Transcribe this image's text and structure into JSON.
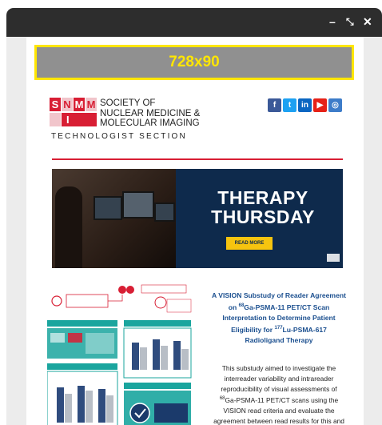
{
  "window": {
    "minimize": "–",
    "restore": "⤡",
    "close": "✕"
  },
  "ad": {
    "label": "728x90"
  },
  "logo": {
    "blocks": [
      "S",
      "N",
      "M",
      "M",
      "I"
    ],
    "lines": [
      "SOCIETY OF",
      "NUCLEAR MEDICINE &",
      "MOLECULAR IMAGING"
    ],
    "section": "TECHNOLOGIST SECTION"
  },
  "social": [
    {
      "icon": "facebook-icon",
      "glyph": "f",
      "color": "#3b5998"
    },
    {
      "icon": "twitter-icon",
      "glyph": "t",
      "color": "#1da1f2"
    },
    {
      "icon": "linkedin-icon",
      "glyph": "in",
      "color": "#0a66c2"
    },
    {
      "icon": "youtube-icon",
      "glyph": "▶",
      "color": "#e62117"
    },
    {
      "icon": "instagram-icon",
      "glyph": "◎",
      "color": "#3d7cc9"
    }
  ],
  "colors": {
    "brand_red": "#d81e34",
    "navy": "#0e2a4c",
    "teal": "#1aa59e",
    "title_blue": "#1b4f8f",
    "ad_yellow": "#ffe600"
  },
  "banner": {
    "title_line1": "THERAPY",
    "title_line2": "THURSDAY",
    "button": "READ MORE"
  },
  "article": {
    "title_line1": "A VISION Substudy of Reader Agreement",
    "title_pre": "on ",
    "title_sup1": "68",
    "title_line2b": "Ga-PSMA-11 PET/CT Scan",
    "title_line3": "Interpretation to Determine Patient",
    "title_pre4": "Eligibility for ",
    "title_sup2": "177",
    "title_line4b": "Lu-PSMA-617",
    "title_line5": "Radioligand Therapy",
    "body_line1": "This substudy aimed to investigate the",
    "body_line2": "interreader variability and intrareader",
    "body_line3": "reproducibility of visual assessments of",
    "body_sup": "68",
    "body_line4b": "Ga-PSMA-11 PET/CT scans using the",
    "body_line5": "VISION read criteria and evaluate the",
    "body_line6": "agreement between read results for this and"
  }
}
